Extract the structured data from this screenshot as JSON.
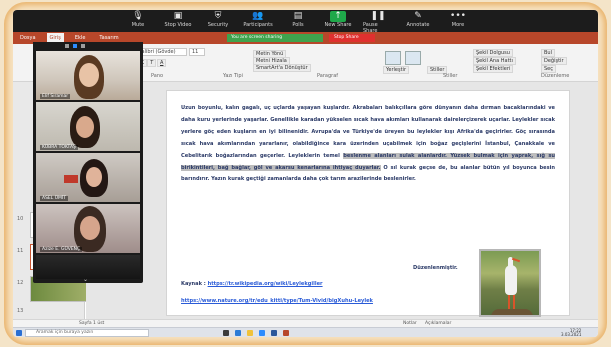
{
  "zoom": {
    "controls": [
      {
        "label": "Mute",
        "icon": "microphone-icon"
      },
      {
        "label": "Stop Video",
        "icon": "video-camera-icon"
      },
      {
        "label": "Security",
        "icon": "shield-icon"
      },
      {
        "label": "Participants",
        "icon": "participants-icon"
      },
      {
        "label": "Polls",
        "icon": "polls-icon"
      },
      {
        "label": "New Share",
        "icon": "share-screen-icon"
      },
      {
        "label": "Pause Share",
        "icon": "pause-icon"
      },
      {
        "label": "Annotate",
        "icon": "pencil-icon"
      },
      {
        "label": "More",
        "icon": "more-icon"
      }
    ],
    "share_banner": "You are screen sharing",
    "stop_share": "Stop Share",
    "participants": [
      {
        "name": "Elif Sıramar"
      },
      {
        "name": "KÜBRA TOKTAŞ"
      },
      {
        "name": "ASEL ÜMİT"
      },
      {
        "name": "Azize E. GÜVENÇ"
      }
    ]
  },
  "word": {
    "tabs": [
      {
        "label": "Dosya",
        "active": false
      },
      {
        "label": "Giriş",
        "active": true
      },
      {
        "label": "Ekle",
        "active": false
      },
      {
        "label": "Tasarım",
        "active": false
      }
    ],
    "font_name": "Calibri (Gövde)",
    "font_size": "11",
    "groups": [
      "Pano",
      "Yazı Tipi",
      "Paragraf",
      "Stiller",
      "Düzenleme"
    ],
    "ribbon_items": [
      "Bul",
      "Değiştir",
      "Seç",
      "Şekil Dolgusu",
      "Şekil Ana Hattı",
      "Şekil Efektleri",
      "Yerleştir",
      "Sunum",
      "Metin Yönü",
      "Metni Hizala",
      "SmartArt'a Dönüştür",
      "Stiller"
    ],
    "thumb_numbers": [
      "10",
      "11",
      "12",
      "13"
    ],
    "document": {
      "paragraph_start": "Uzun boyunlu, kalın gagalı, uç uçlarda yaşayan kuşlardır. Akrabaları balıkçıllara göre dünyanın daha dırman bacaklarındaki ve daha kuru yerlerinde yaşarlar. Genellikle karadan yükselen sıcak hava akımları kullanarak dairelerçizerek uçarlar. Leylekler sıcak yerlere göç eden kuşların en iyi bilinenidir. Avrupa'da ve Türkiye'de üreyen bu leylekler kışı Afrika'da geçirirler. Göç sırasında sıcak hava akımlarından yararlanır, olabildiğince kara üzerinden uçabilmek için boğaz geçişlerini İstanbul, Çanakkale ve Cebelitarık boğazlarından geçerler. Leyleklerin temel ",
      "highlight": "beslenme alanları sulak alanlardır. Yüzsek bulmak için yaprak, sığ su birikintileri, bağ bağlar, göl ve akarsu kenarlarına ihtiyaç duyarlar.",
      "paragraph_end": " O sıl kurak geçse de, bu alanlar bütün yıl boyunca besin barındırır. Yazın kurak geçtiği zamanlarda daha çok tarım arazilerinde beslenirler.",
      "signature": "Düzenlenmiştir.",
      "source_label": "Kaynak : ",
      "source_link": "https://tr.wikipedia.org/wiki/Leylekgiller",
      "second_link": "https://www.nature.org/tr/edu_kitti/type/Tum-Vivid/bigXuhu-Leylek"
    },
    "status": {
      "page": "Sayfa 1 üst",
      "notes": "Notlar",
      "comments": "Açıklamalar"
    }
  },
  "taskbar": {
    "search_placeholder": "Aramak için buraya yazın",
    "time": "17:22",
    "date": "3.03.2021"
  },
  "colors": {
    "word_accent": "#b7472a",
    "zoom_bar": "#1c1c1c",
    "share_green": "#3fa34d",
    "stop_red": "#e0302f",
    "doc_text": "#2b3a67"
  }
}
